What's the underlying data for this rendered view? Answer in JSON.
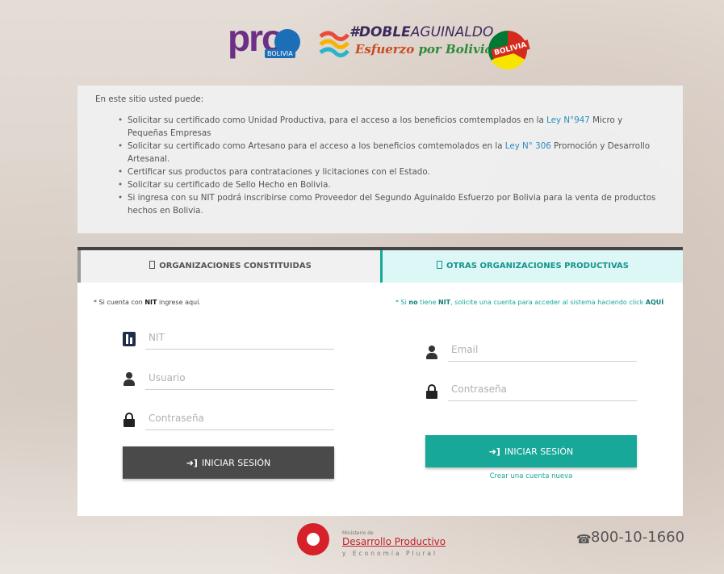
{
  "header": {
    "pro_logo_text": "pro",
    "pro_logo_tag": "BOLIVIA",
    "doble_line1_bold": "#DOBLE",
    "doble_line1_rest": "AGUINALDO",
    "doble_line2_a": "Esfuerzo ",
    "doble_line2_b": "por Bolivia",
    "hecho_badge_text": "BOLIVIA"
  },
  "info": {
    "intro": "En este sitio usted puede:",
    "items": [
      {
        "pre": "Solicitar su certificado como Unidad Productiva, para el acceso a los beneficios comtemplados en la ",
        "link": "Ley N°947",
        "post": " Micro y Pequeñas Empresas"
      },
      {
        "pre": "Solicitar su certificado como Artesano para el acceso a los beneficios comtemolados en la ",
        "link": "Ley N° 306",
        "post": " Promoción y Desarrollo Artesanal."
      },
      {
        "pre": "Certificar sus productos para contrataciones y licitaciones con el Estado.",
        "link": "",
        "post": ""
      },
      {
        "pre": "Solicitar su certificado de Sello Hecho en Bolivia.",
        "link": "",
        "post": ""
      },
      {
        "pre": "Si ingresa con su NIT podrá inscribirse como Proveedor del Segundo Aguinaldo Esfuerzo por Bolivia para la venta de productos hechos en Bolivia.",
        "link": "",
        "post": ""
      }
    ]
  },
  "tabs": {
    "left_label": "ORGANIZACIONES CONSTITUIDAS",
    "right_label": "OTRAS ORGANIZACIONES PRODUCTIVAS"
  },
  "left": {
    "note_pre": "* Si cuenta con ",
    "note_bold": "NIT",
    "note_post": " ingrese aquí.",
    "nit_placeholder": "NIT",
    "user_placeholder": "Usuario",
    "password_placeholder": "Contraseña",
    "login_label": "INICIAR SESIÓN"
  },
  "right": {
    "note_pre": "* Si ",
    "note_bold1": "no",
    "note_mid1": " tiene ",
    "note_bold2": "NIT",
    "note_mid2": ", solicite una cuenta para acceder al sistema haciendo click ",
    "note_bold3": "AQUÍ",
    "email_placeholder": "Email",
    "password_placeholder": "Contraseña",
    "login_label": "INICIAR SESIÓN",
    "create_account": "Crear una cuenta nueva"
  },
  "footer": {
    "ministry_small": "Ministerio de",
    "ministry_big": "Desarrollo Productivo",
    "ministry_sub": "y Economía Plural",
    "phone": "800-10-1660"
  },
  "colors": {
    "teal": "#17a899",
    "dark_button": "#4a4a4a",
    "link_blue": "#2a8fb9",
    "ministry_red": "#d6212b"
  }
}
